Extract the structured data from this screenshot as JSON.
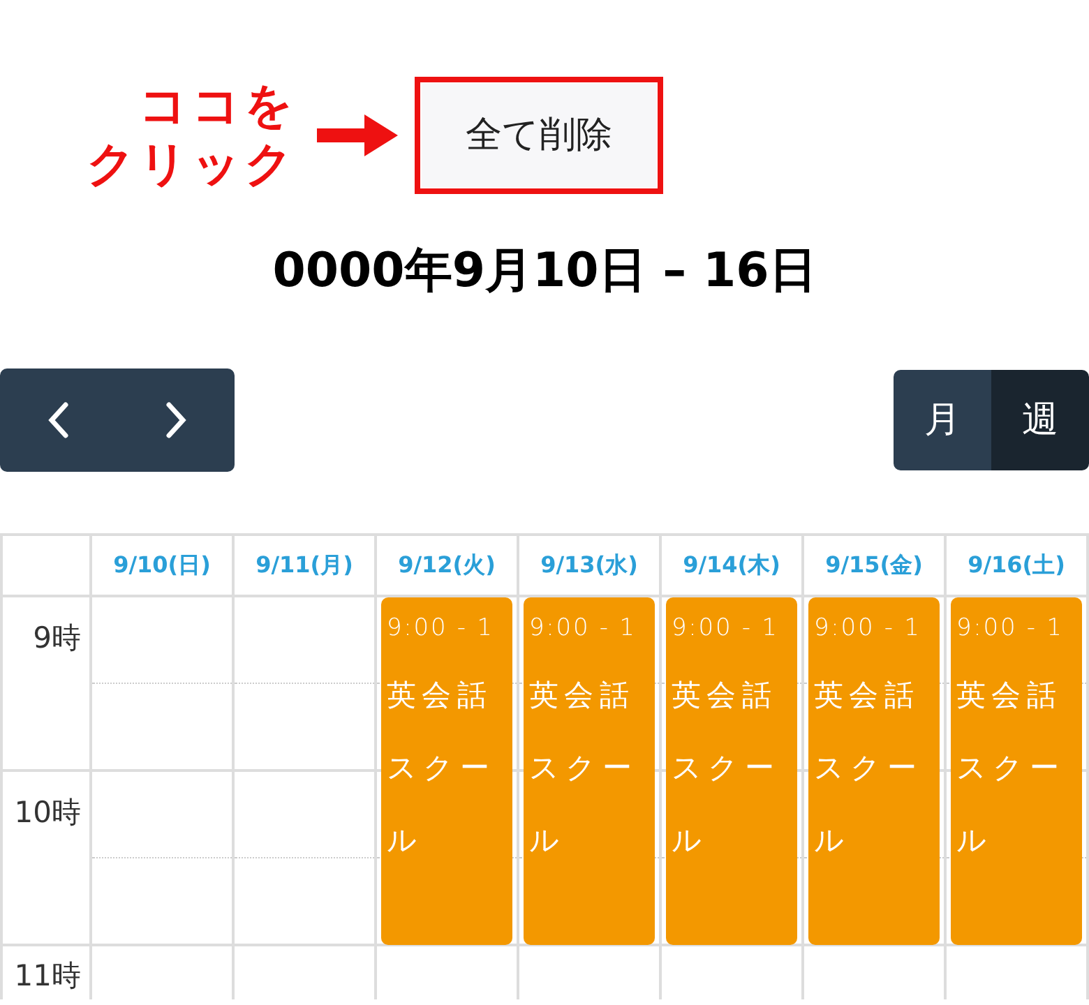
{
  "annotation": {
    "lines": [
      "ココを",
      "クリック"
    ]
  },
  "delete_all_button": {
    "label": "全て削除"
  },
  "title": "0000年9月10日 – 16日",
  "view_toggle": [
    {
      "label": "月",
      "selected": false
    },
    {
      "label": "週",
      "selected": true
    }
  ],
  "calendar": {
    "hours": [
      "9時",
      "10時",
      "11時"
    ],
    "days": [
      {
        "label": "9/10(日)"
      },
      {
        "label": "9/11(月)"
      },
      {
        "label": "9/12(火)",
        "events": [
          {
            "time": "9:00 - 1",
            "title": "英会話スクール"
          }
        ]
      },
      {
        "label": "9/13(水)",
        "events": [
          {
            "time": "9:00 - 1",
            "title": "英会話スクール"
          }
        ]
      },
      {
        "label": "9/14(木)",
        "events": [
          {
            "time": "9:00 - 1",
            "title": "英会話スクール"
          }
        ]
      },
      {
        "label": "9/15(金)",
        "events": [
          {
            "time": "9:00 - 1",
            "title": "英会話スクール"
          }
        ]
      },
      {
        "label": "9/16(土)",
        "events": [
          {
            "time": "9:00 - 1",
            "title": "英会話スクール"
          }
        ]
      }
    ]
  }
}
